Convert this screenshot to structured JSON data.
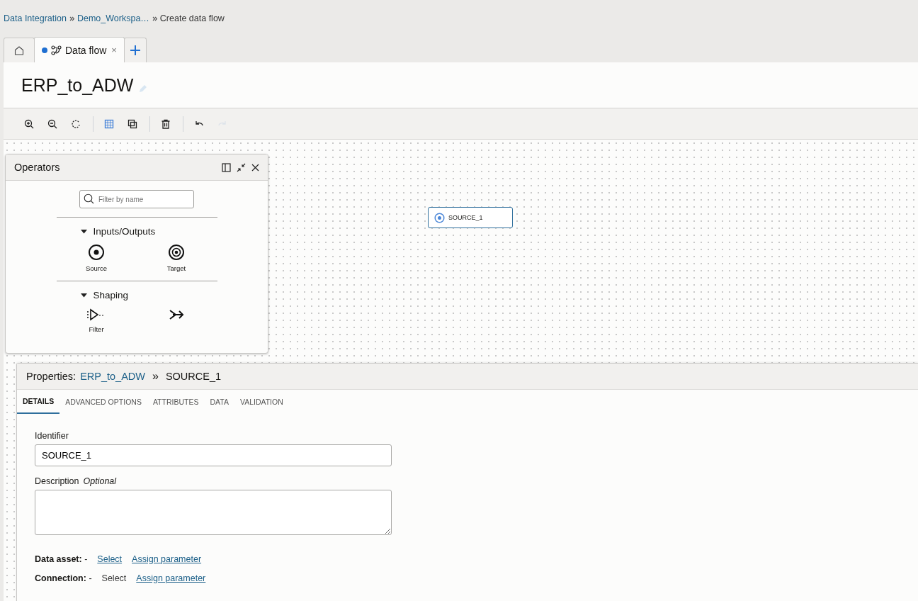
{
  "breadcrumb": [
    {
      "label": "Data Integration",
      "link": true
    },
    {
      "label": "Demo_Workspa…",
      "link": true
    },
    {
      "label": "Create data flow",
      "link": false
    }
  ],
  "tabs": [
    {
      "kind": "home",
      "selected": false
    },
    {
      "kind": "dataflow",
      "label": "Data flow",
      "selected": true,
      "modified": true,
      "close": "×"
    }
  ],
  "title": "ERP_to_ADW",
  "toolbar": [
    {
      "kind": "zoom-in",
      "active": false,
      "disabled": false
    },
    {
      "kind": "zoom-out",
      "active": false,
      "disabled": false
    },
    {
      "kind": "reset",
      "active": false,
      "disabled": false
    },
    {
      "kind": "sep"
    },
    {
      "kind": "grid",
      "active": true,
      "disabled": false
    },
    {
      "kind": "copy",
      "active": false,
      "disabled": false
    },
    {
      "kind": "sep"
    },
    {
      "kind": "delete",
      "active": false,
      "disabled": false
    },
    {
      "kind": "sep"
    },
    {
      "kind": "undo",
      "active": false,
      "disabled": false
    },
    {
      "kind": "redo",
      "active": false,
      "disabled": true
    }
  ],
  "operators": {
    "title": "Operators",
    "search": {
      "placeholder": "Filter by name"
    },
    "groups": [
      {
        "label": "Inputs/Outputs",
        "expanded": true,
        "items": [
          {
            "kind": "source",
            "label": "Source"
          },
          {
            "kind": "target",
            "label": "Target"
          }
        ]
      },
      {
        "label": "Shaping",
        "expanded": true,
        "items": [
          {
            "kind": "filter",
            "label": "Filter"
          },
          {
            "kind": "join"
          }
        ]
      }
    ]
  },
  "canvas": {
    "nodes": [
      {
        "kind": "source",
        "label": "SOURCE_1"
      }
    ]
  },
  "properties": {
    "prefix": "Properties:",
    "link": "ERP_to_ADW",
    "separator": "»",
    "current": "SOURCE_1",
    "tabs": [
      {
        "label": "DETAILS",
        "selected": true
      },
      {
        "label": "ADVANCED OPTIONS",
        "selected": false
      },
      {
        "label": "ATTRIBUTES",
        "selected": false
      },
      {
        "label": "DATA",
        "selected": false
      },
      {
        "label": "VALIDATION",
        "selected": false
      }
    ],
    "identifier": {
      "label": "Identifier",
      "value": "SOURCE_1"
    },
    "description": {
      "label": "Description",
      "hint": "Optional"
    },
    "rows": [
      {
        "label": "**Data asset:** -",
        "actions": [
          {
            "label": "Select",
            "link": true
          },
          {
            "label": "Assign parameter",
            "link": true
          }
        ]
      },
      {
        "label": "**Connection:** -",
        "actions": [
          {
            "label": "Select",
            "link": false
          },
          {
            "label": "Assign parameter",
            "link": true
          }
        ]
      }
    ]
  }
}
